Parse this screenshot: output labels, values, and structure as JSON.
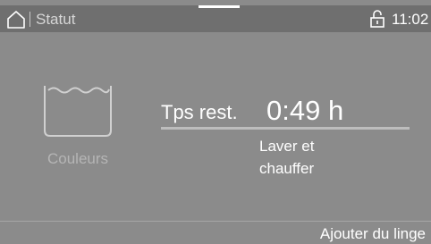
{
  "status_bar": {
    "title": "Statut",
    "time": "11:02",
    "icons": {
      "home": "home-icon",
      "lock": "lock-open-icon"
    }
  },
  "program": {
    "name": "Couleurs",
    "icon": "washing-tub-icon"
  },
  "remaining": {
    "label": "Tps rest.",
    "value": "0:49 h",
    "progress": 0
  },
  "phase": {
    "line1": "Laver et",
    "line2": "chauffer"
  },
  "actions": {
    "add_laundry": "Ajouter du linge"
  },
  "colors": {
    "background": "#8b8b8b",
    "status_bar": "#6f6f6f",
    "text": "#ffffff",
    "muted_text": "#b5b5b5"
  }
}
